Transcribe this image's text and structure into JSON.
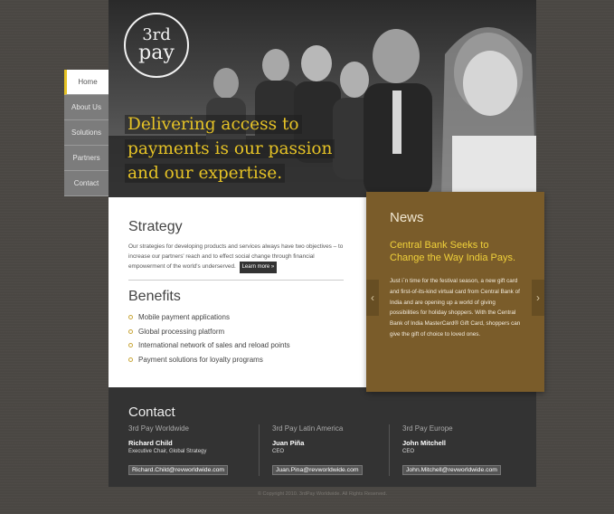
{
  "logo": {
    "line1": "3rd",
    "line2": "pay"
  },
  "hero": {
    "tagline_lines": [
      "Delivering access to",
      "payments is our passion",
      "and our expertise."
    ]
  },
  "nav": {
    "items": [
      {
        "label": "Home"
      },
      {
        "label": "About  Us"
      },
      {
        "label": "Solutions"
      },
      {
        "label": "Partners"
      },
      {
        "label": "Contact"
      }
    ]
  },
  "strategy": {
    "title": "Strategy",
    "text": "Our strategies for developing products and services always have two objectives – to increase our partners' reach and to effect social change through financial empowerment of the world's underserved.",
    "learn_more": "Learn more »"
  },
  "benefits": {
    "title": "Benefits",
    "items": [
      "Mobile payment applications",
      "Global processing platform",
      "International network of sales and reload points",
      "Payment solutions for loyalty programs"
    ]
  },
  "news": {
    "title": "News",
    "headline": "Central Bank Seeks to Change the Way India Pays.",
    "body": "Just i`n time for the festival season, a new gift card and first-of-its-kind virtual card from Central Bank of India and are opening up a world of giving possibilities for holiday shoppers. With the Central Bank of India MasterCard® Gift Card, shoppers can give the gift of choice to loved ones.",
    "prev_icon": "‹",
    "next_icon": "›"
  },
  "contact": {
    "title": "Contact",
    "columns": [
      {
        "region": "3rd Pay Worldwide",
        "name": "Richard Child",
        "role": "Executive Chair, Global Strategy",
        "email": "Richard.Child@revworldwide.com"
      },
      {
        "region": "3rd Pay Latin America",
        "name": "Juan Piña",
        "role": "CEO",
        "email": "Juan.Pina@revworldwide.com"
      },
      {
        "region": "3rd Pay Europe",
        "name": "John Mitchell",
        "role": "CEO",
        "email": "John.Mitchell@revworldwide.com"
      }
    ]
  },
  "footer": {
    "copyright": "© Copyright 2010. 3rdPay Worldwide. All Rights Reserved."
  },
  "colors": {
    "accent": "#e6c326",
    "news_bg": "#7a5c2a",
    "contact_bg": "#333333"
  }
}
